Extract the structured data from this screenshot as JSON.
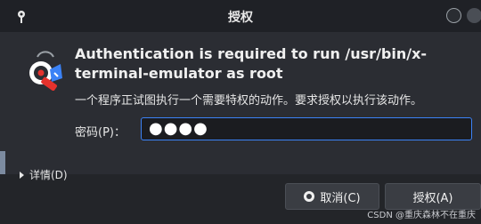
{
  "window": {
    "title": "授权",
    "title_icon": "key-icon",
    "minimize_icon": "minimize-icon",
    "close_icon": "close-icon"
  },
  "dialog": {
    "icon": "authentication-lock-icon",
    "headline": "Authentication is required to run /usr/bin/x-terminal-emulator as root",
    "subtext": "一个程序正试图执行一个需要特权的动作。要求授权以执行该动作。",
    "password_label": "密码(P)：",
    "password_value": "●●●●",
    "details_label": "详情(D)"
  },
  "buttons": {
    "cancel_label": "取消(C)",
    "ok_label": "授权(A)"
  },
  "watermark": "CSDN @重庆森林不在重庆",
  "colors": {
    "accent": "#3b82f6",
    "dialog_bg": "#2b2d33",
    "titlebar_bg": "#1f2126"
  }
}
